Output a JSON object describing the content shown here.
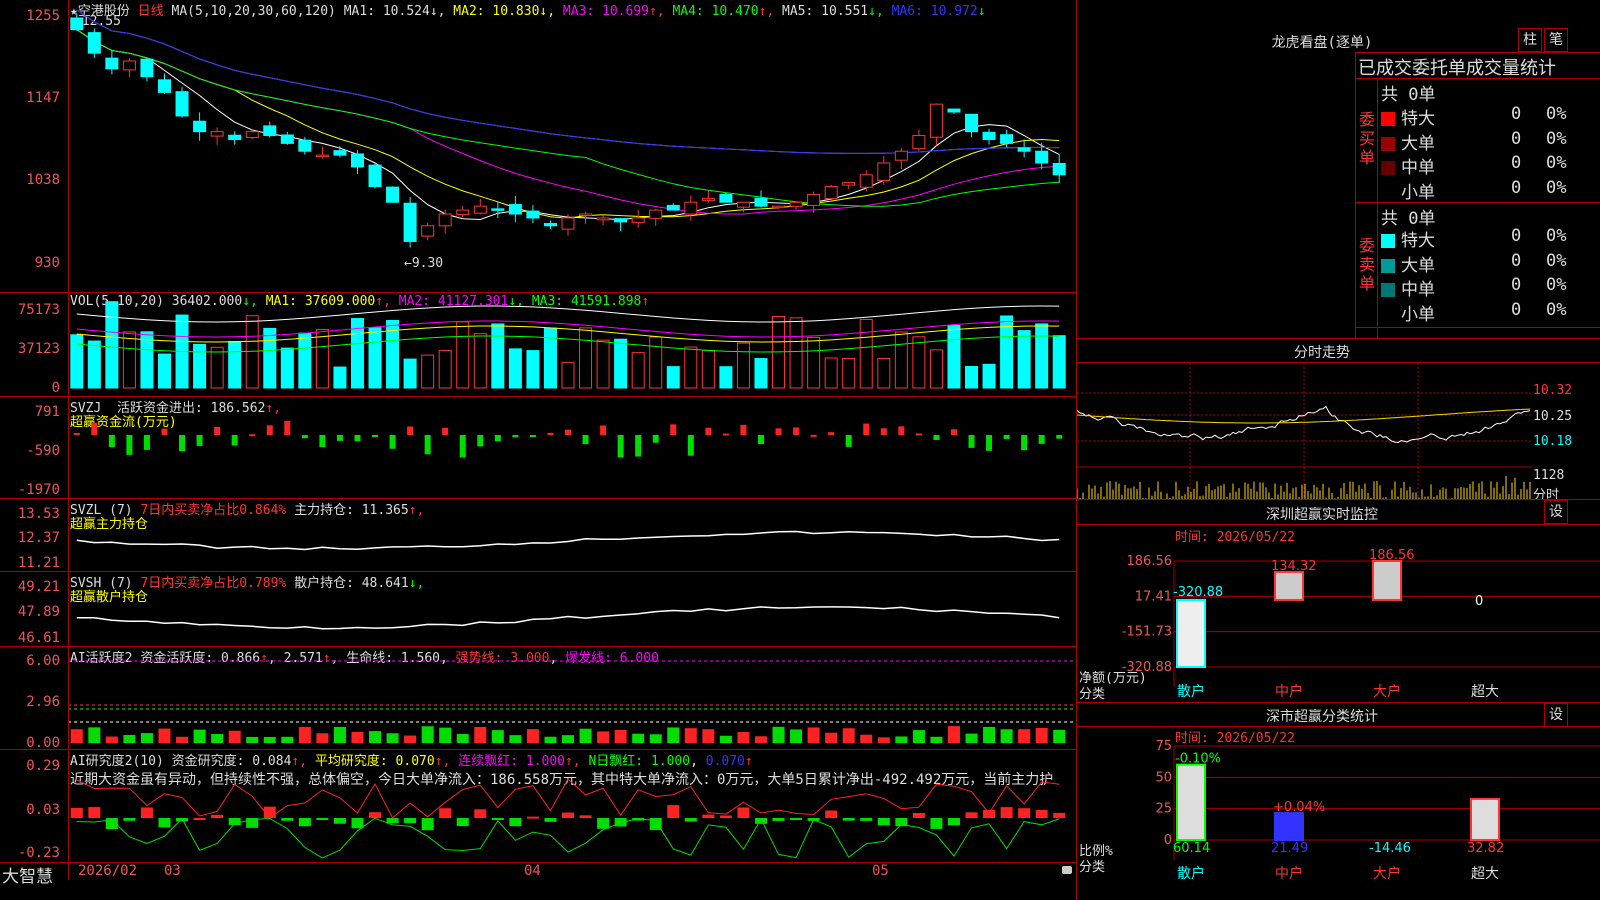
{
  "app": {
    "brand": "大智慧"
  },
  "stock": {
    "name": "空港股份",
    "period": "日线",
    "high_note": "12.55",
    "low_note": "9.30"
  },
  "ma": {
    "label": "MA(5,10,20,30,60,120)",
    "ma1": "MA1: 10.524",
    "ma2": "MA2: 10.830",
    "ma3": "MA3: 10.699",
    "ma4": "MA4: 10.470",
    "ma5": "MA5: 10.551",
    "ma6": "MA6: 10.972"
  },
  "price_axis": [
    "1255",
    "1147",
    "1038",
    "930"
  ],
  "vol": {
    "label": "VOL(5,10,20)",
    "value": "36402.000",
    "ma1": "MA1: 37609.000",
    "ma2": "MA2: 41127.301",
    "ma3": "MA3: 41591.898",
    "axis": [
      "75173",
      "37123",
      "0"
    ]
  },
  "svzj": {
    "label": "SVZJ",
    "line": "活跃资金进出: 186.562",
    "sub": "超赢资金流(万元)",
    "axis": [
      "791",
      "-590",
      "-1970"
    ]
  },
  "svzl": {
    "label": "SVZL (7)",
    "ratio": "7日内买卖净占比0.864%",
    "hold": "主力持仓: 11.365",
    "sub": "超赢主力持仓",
    "axis": [
      "13.53",
      "12.37",
      "11.21"
    ]
  },
  "svsh": {
    "label": "SVSH (7)",
    "ratio": "7日内买卖净占比0.789%",
    "hold": "散户持仓: 48.641",
    "sub": "超赢散户持仓",
    "axis": [
      "49.21",
      "47.89",
      "46.61"
    ]
  },
  "ai_active": {
    "label": "AI活跃度2",
    "text": "资金活跃度: 0.866",
    "v2": "2.571",
    "life": "生命线: 1.560",
    "strong": "强势线: 3.000",
    "burst": "爆发线: 6.000",
    "axis": [
      "6.00",
      "2.96",
      "0.00"
    ]
  },
  "ai_research": {
    "label": "AI研究度2(10)",
    "text": "资金研究度: 0.084",
    "avg": "平均研究度: 0.070",
    "red": "连续飘红: 1.000",
    "nred": "N日飘红: 1.000",
    "v": "0.070",
    "axis": [
      "0.29",
      "0.03",
      "-0.23"
    ],
    "note": "近期大资金虽有异动，但持续性不强，总体偏空，今日大单净流入：186.558万元，其中特大单净流入：0万元，大单5日累计净出-492.492万元，当前主力护"
  },
  "date_axis": [
    "2026/02",
    "03",
    "04",
    "05"
  ],
  "dragon": {
    "title": "龙虎看盘(逐单)",
    "btn1": "柱",
    "btn2": "笔",
    "stat_title": "已成交委托单成交量统计",
    "buy_label": "委买单",
    "sell_label": "委卖单",
    "buy_total": "共 0单",
    "sell_total": "共 0单",
    "buy_rows": [
      {
        "name": "特大",
        "n": "0",
        "p": "0%",
        "color": "#ff0000"
      },
      {
        "name": "大单",
        "n": "0",
        "p": "0%",
        "color": "#990000"
      },
      {
        "name": "中单",
        "n": "0",
        "p": "0%",
        "color": "#660000"
      },
      {
        "name": "小单",
        "n": "0",
        "p": "0%",
        "color": "#000000"
      }
    ],
    "sell_rows": [
      {
        "name": "特大",
        "n": "0",
        "p": "0%",
        "color": "#00ffff"
      },
      {
        "name": "大单",
        "n": "0",
        "p": "0%",
        "color": "#009999"
      },
      {
        "name": "中单",
        "n": "0",
        "p": "0%",
        "color": "#007777"
      },
      {
        "name": "小单",
        "n": "0",
        "p": "0%",
        "color": "#000000"
      }
    ]
  },
  "intraday": {
    "title": "分时走势",
    "axis": [
      "10.32",
      "10.25",
      "10.18"
    ],
    "vol_axis": [
      "1128",
      "分时"
    ]
  },
  "sz_monitor": {
    "title": "深圳超赢实时监控",
    "btn": "设",
    "date": "时间: 2026/05/22",
    "axis": [
      "186.56",
      "17.41",
      "-151.73",
      "-320.88"
    ],
    "unit": "净额(万元)",
    "cat_label": "分类",
    "cats": [
      "散户",
      "中户",
      "大户",
      "超大"
    ],
    "values": [
      "-320.88",
      "134.32",
      "186.56",
      "0"
    ]
  },
  "sz_class": {
    "title": "深市超赢分类统计",
    "btn": "设",
    "date": "时间: 2026/05/22",
    "axis": [
      "75",
      "50",
      "25",
      "0"
    ],
    "unit": "比例%",
    "cat_label": "分类",
    "cats": [
      "散户",
      "中户",
      "大户",
      "超大"
    ],
    "top": [
      "-0.10%",
      "+0.04%",
      "",
      ""
    ],
    "values": [
      "60.14",
      "21.49",
      "-14.46",
      "32.82"
    ]
  },
  "chart_data": [
    {
      "type": "candlestick",
      "title": "空港股份 日线",
      "close": [
        12.3,
        12.0,
        11.8,
        11.9,
        11.7,
        11.5,
        11.2,
        11.0,
        11.0,
        10.9,
        11.0,
        10.95,
        10.85,
        10.75,
        10.7,
        10.7,
        10.55,
        10.3,
        10.1,
        9.6,
        9.8,
        9.95,
        10.0,
        10.05,
        10.0,
        9.95,
        9.9,
        9.8,
        9.9,
        9.95,
        9.9,
        9.85,
        9.9,
        10.0,
        10.0,
        10.1,
        10.15,
        10.1,
        10.1,
        10.05,
        10.05,
        10.1,
        10.2,
        10.3,
        10.35,
        10.45,
        10.6,
        10.75,
        10.95,
        11.35,
        11.25,
        11.0,
        10.9,
        10.85,
        10.75,
        10.6,
        10.45
      ],
      "ylim": [
        9.3,
        12.55
      ]
    },
    {
      "type": "bar",
      "title": "VOL",
      "ylim": [
        0,
        75173
      ]
    },
    {
      "type": "bar",
      "title": "深圳超赢实时监控",
      "categories": [
        "散户",
        "中户",
        "大户",
        "超大"
      ],
      "values": [
        -320.88,
        134.32,
        186.56,
        0
      ]
    },
    {
      "type": "bar",
      "title": "深市超赢分类统计",
      "categories": [
        "散户",
        "中户",
        "大户",
        "超大"
      ],
      "values": [
        60.14,
        21.49,
        -14.46,
        32.82
      ]
    }
  ],
  "colors": {
    "up": "#ff3333",
    "down": "#00ffff",
    "grid": "#aa0000"
  }
}
